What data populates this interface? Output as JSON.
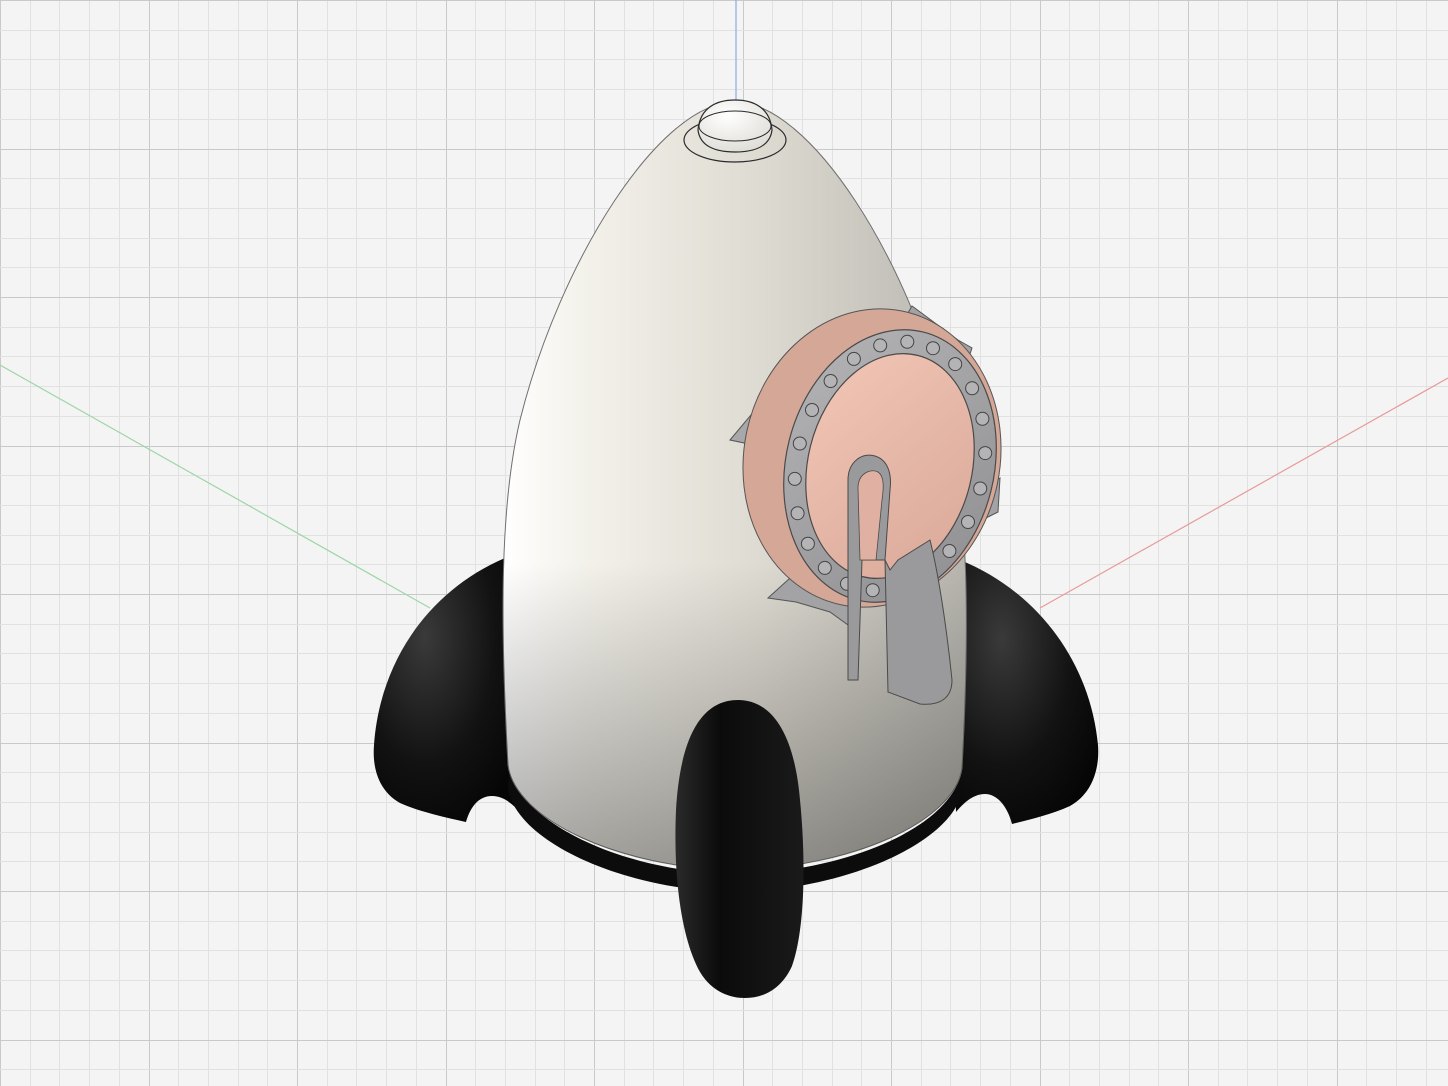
{
  "app": {
    "view": "3d-viewport",
    "background_color": "#f4f4f4",
    "grid_minor_color": "#e1e1e1",
    "grid_major_color": "#c9c9c9"
  },
  "axes": {
    "x_color": "#e89a9a",
    "y_color": "#9fd6a8",
    "z_color": "#8aa9e8"
  },
  "model": {
    "body_color": "#e8e6df",
    "fin_color": "#111111",
    "window_frame_color": "#9d9d9f",
    "window_glass_color": "#e8b9a8",
    "icons": [
      "rocket-body",
      "porthole-window",
      "fin",
      "nose-tip"
    ]
  }
}
